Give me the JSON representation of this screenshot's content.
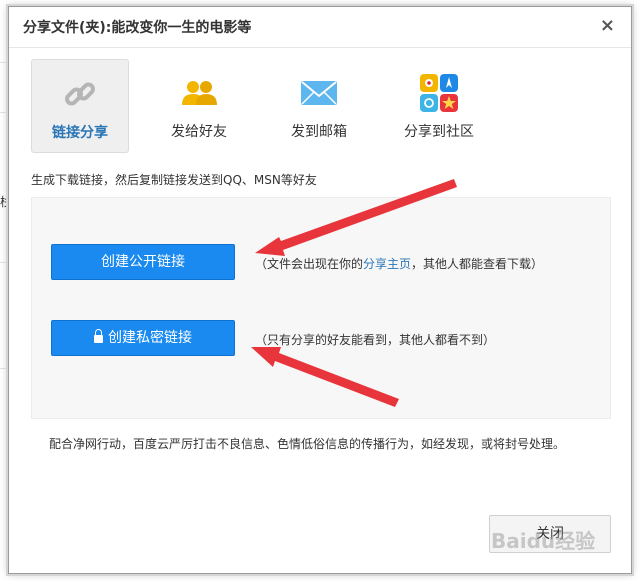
{
  "dialog": {
    "title": "分享文件(夹):能改变你一生的电影等",
    "close_glyph": "×"
  },
  "tabs": [
    {
      "label": "链接分享",
      "icon": "link-icon",
      "active": true
    },
    {
      "label": "发给好友",
      "icon": "friends-icon",
      "active": false
    },
    {
      "label": "发到邮箱",
      "icon": "mail-icon",
      "active": false
    },
    {
      "label": "分享到社区",
      "icon": "community-icon",
      "active": false
    }
  ],
  "intro": "生成下载链接，然后复制链接发送到QQ、MSN等好友",
  "public_link": {
    "button_label": "创建公开链接",
    "note_before": "（文件会出现在你的",
    "note_link": "分享主页",
    "note_after": "，其他人都能查看下载）"
  },
  "private_link": {
    "button_label": "创建私密链接",
    "note": "（只有分享的好友能看到，其他人都看不到）"
  },
  "footer_note": "配合净网行动，百度云严厉打击不良信息、色情低俗信息的传播行为，如经发现，或将封号处理。",
  "close_button": "关闭",
  "watermark": "Baidu经验",
  "background_edge_char": "栈",
  "colors": {
    "primary_button": "#1a8af0",
    "link": "#2a76b7",
    "arrow": "#e8353c"
  }
}
